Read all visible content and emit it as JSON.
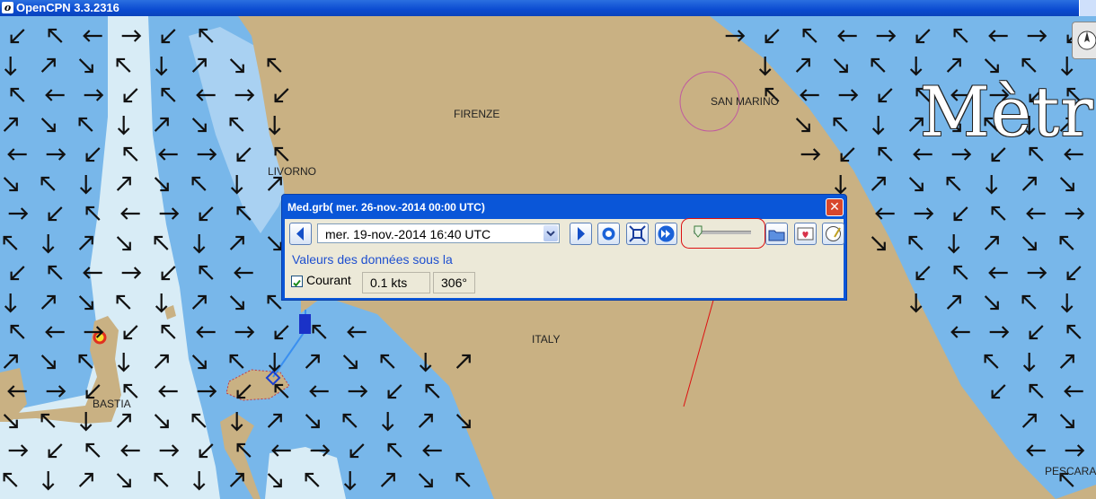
{
  "window": {
    "title": "OpenCPN 3.3.2316",
    "app_icon": "opencpn-icon"
  },
  "colors": {
    "land": "#c9b183",
    "sea_deep": "#78b7ea",
    "sea_shallow": "#d8ecf6",
    "title_bar": "#0b4bd1",
    "dialog_frame": "#0a56d8",
    "dialog_body": "#ece9d8",
    "highlight": "#dd1111"
  },
  "places": [
    "FIRENZE",
    "SAN MARINO",
    "LIVORNO",
    "ITALY",
    "BASTIA",
    "PESCARA"
  ],
  "scale_overlay": "Mètre",
  "grib": {
    "title": "Med.grb( mer. 26-nov.-2014 00:00  UTC)",
    "selected_time": "mer. 19-nov.-2014 16:40  UTC",
    "section_label": "Valeurs des données sous la",
    "layer_label": "Courant",
    "layer_checked": true,
    "current_speed": "0.1 kts",
    "current_direction": "306°",
    "slider_position": 0.05,
    "icons": [
      "prev-icon",
      "next-icon",
      "now-icon",
      "zoom-extent-icon",
      "play-icon",
      "open-file-icon",
      "settings-icon",
      "request-icon"
    ]
  }
}
